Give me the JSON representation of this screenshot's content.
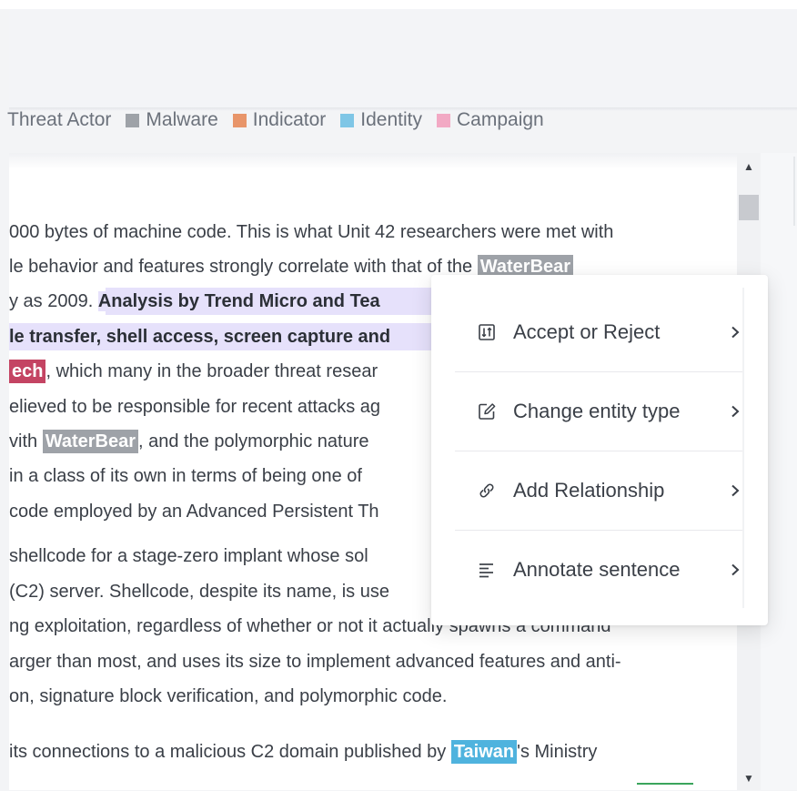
{
  "legend": [
    {
      "label": "Threat Actor",
      "color": "#ffffff"
    },
    {
      "label": "Malware",
      "color": "#9ea2a8"
    },
    {
      "label": "Indicator",
      "color": "#e8956a"
    },
    {
      "label": "Identity",
      "color": "#7fc6e6"
    },
    {
      "label": "Campaign",
      "color": "#f2a9c4"
    }
  ],
  "document": {
    "lines": [
      {
        "before": "000 bytes of machine code. This is what Unit 42 researchers were met with",
        "hl": "",
        "hl_type": "",
        "after": ""
      },
      {
        "before": "le behavior and features strongly correlate with that of the ",
        "hl": "WaterBear",
        "hl_type": "malware",
        "after": ""
      },
      {
        "before": "y as 2009. ",
        "hl": "Analysis by Trend Micro and Tea",
        "hl_type": "sentence",
        "after": ""
      },
      {
        "before": "",
        "hl": "le transfer, shell access, screen capture and",
        "hl_type": "sentence",
        "after": ""
      },
      {
        "before": "",
        "hl": "ech",
        "hl_type": "threat",
        "after": ", which many in the broader threat resear"
      },
      {
        "before": "elieved to be responsible for recent attacks ag",
        "hl": "",
        "hl_type": "",
        "after": ""
      },
      {
        "before": "vith ",
        "hl": "WaterBear",
        "hl_type": "malware",
        "after": ", and the polymorphic nature"
      },
      {
        "before": " in a class of its own in terms of being one of",
        "hl": "",
        "hl_type": "",
        "after": ""
      },
      {
        "before": "code employed by an Advanced Persistent Th",
        "hl": "",
        "hl_type": "",
        "after": ""
      },
      {
        "before": " shellcode for a stage-zero implant whose sol",
        "hl": "",
        "hl_type": "",
        "after": ""
      },
      {
        "before": " (C2) server. Shellcode, despite its name, is use",
        "hl": "",
        "hl_type": "",
        "after": ""
      },
      {
        "before": "ng exploitation, regardless of whether or not it actually spawns a command",
        "hl": "",
        "hl_type": "",
        "after": ""
      },
      {
        "before": "arger than most, and uses its size to implement advanced features and anti-",
        "hl": "",
        "hl_type": "",
        "after": ""
      },
      {
        "before": "on, signature block verification, and polymorphic code.",
        "hl": "",
        "hl_type": "",
        "after": ""
      },
      {
        "before": "its connections to a malicious C2 domain published by ",
        "hl": "Taiwan",
        "hl_type": "identity",
        "after": "'s Ministry"
      }
    ]
  },
  "context_menu": {
    "items": [
      {
        "label": "Accept or Reject",
        "icon": "accept-reject-icon"
      },
      {
        "label": "Change entity type",
        "icon": "edit-icon"
      },
      {
        "label": "Add Relationship",
        "icon": "link-icon"
      },
      {
        "label": "Annotate sentence",
        "icon": "align-left-icon"
      }
    ]
  },
  "scrollbar": {
    "up": "▲",
    "down": "▼"
  }
}
